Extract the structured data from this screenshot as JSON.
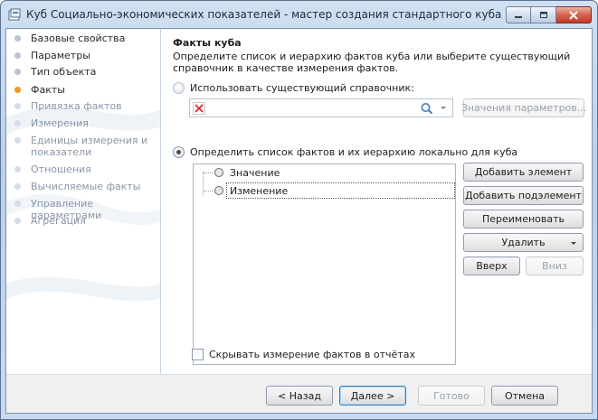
{
  "window": {
    "title": "Куб Социально-экономических показателей - мастер создания стандартного куба",
    "minimize_icon": "minimize-icon",
    "maximize_icon": "maximize-icon",
    "close_icon": "close-icon"
  },
  "sidebar": {
    "items": [
      {
        "label": "Базовые свойства",
        "state": "done"
      },
      {
        "label": "Параметры",
        "state": "done"
      },
      {
        "label": "Тип объекта",
        "state": "done"
      },
      {
        "label": "Факты",
        "state": "active"
      },
      {
        "label": "Привязка фактов",
        "state": "disabled"
      },
      {
        "label": "Измерения",
        "state": "disabled"
      },
      {
        "label": "Единицы измерения и показатели",
        "state": "disabled"
      },
      {
        "label": "Отношения",
        "state": "disabled"
      },
      {
        "label": "Вычисляемые факты",
        "state": "disabled"
      },
      {
        "label": "Управление параметрами",
        "state": "disabled"
      },
      {
        "label": "Агрегация",
        "state": "disabled"
      }
    ],
    "active_color": "#f29a1e"
  },
  "main": {
    "title": "Факты куба",
    "description": "Определите список и иерархию фактов куба или выберите существующий справочник в качестве измерения фактов.",
    "use_existing_option": "Использовать существующий справочник:",
    "use_existing_checked": false,
    "reference_value": "",
    "param_values_button": "Значения параметров...",
    "local_option": "Определить список фактов и их иерархию локально для куба",
    "local_checked": true,
    "facts": [
      {
        "label": "Значение",
        "selected": false
      },
      {
        "label": "Изменение",
        "selected": true
      }
    ],
    "buttons": {
      "add_element": "Добавить элемент",
      "add_child": "Добавить подэлемент",
      "rename": "Переименовать",
      "delete": "Удалить",
      "up": "Вверх",
      "down": "Вниз"
    },
    "hide_dimension_label": "Скрывать измерение фактов в отчётах",
    "hide_dimension_checked": false
  },
  "footer": {
    "back": "< Назад",
    "next": "Далее >",
    "finish": "Готово",
    "cancel": "Отмена"
  }
}
